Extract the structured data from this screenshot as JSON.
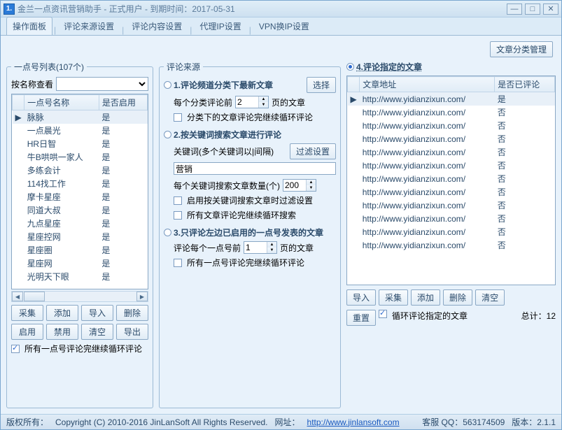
{
  "window": {
    "icon_text": "1.",
    "title": "金兰一点资讯营销助手 - 正式用户 - 到期时间：2017-05-31"
  },
  "tabs": [
    "操作面板",
    "评论来源设置",
    "评论内容设置",
    "代理IP设置",
    "VPN换IP设置"
  ],
  "btn_category_mgmt": "文章分类管理",
  "left": {
    "legend": "一点号列表(107个)",
    "filter_label": "按名称查看",
    "col1": "一点号名称",
    "col2": "是否启用",
    "rows": [
      {
        "name": "脉脉",
        "enabled": "是",
        "sel": true
      },
      {
        "name": "一点晨光",
        "enabled": "是"
      },
      {
        "name": "HR日智",
        "enabled": "是"
      },
      {
        "name": "牛B哄哄一家人",
        "enabled": "是"
      },
      {
        "name": "多练会计",
        "enabled": "是"
      },
      {
        "name": "114找工作",
        "enabled": "是"
      },
      {
        "name": "摩卡星座",
        "enabled": "是"
      },
      {
        "name": "同道大叔",
        "enabled": "是"
      },
      {
        "name": "九点星座",
        "enabled": "是"
      },
      {
        "name": "星座控网",
        "enabled": "是"
      },
      {
        "name": "星座圈",
        "enabled": "是"
      },
      {
        "name": "星座网",
        "enabled": "是"
      },
      {
        "name": "光明天下眼",
        "enabled": "是"
      }
    ],
    "btns": [
      "采集",
      "添加",
      "导入",
      "删除",
      "启用",
      "禁用",
      "清空",
      "导出"
    ],
    "loop_chk": "所有一点号评论完继续循环评论"
  },
  "mid": {
    "legend": "评论来源",
    "sec1": {
      "title": "1.评论频道分类下最新文章",
      "select_btn": "选择",
      "line1a": "每个分类评论前",
      "line1_val": "2",
      "line1b": "页的文章",
      "chk1": "分类下的文章评论完继续循环评论"
    },
    "sec2": {
      "title": "2.按关键词搜索文章进行评论",
      "kw_label": "关键词(多个关键词以|间隔)",
      "filter_btn": "过滤设置",
      "kw_val": "营销",
      "cnt_label": "每个关键词搜索文章数量(个)",
      "cnt_val": "200",
      "chk1": "启用按关键词搜索文章时过滤设置",
      "chk2": "所有文章评论完继续循环搜索"
    },
    "sec3": {
      "title": "3.只评论左边已启用的一点号发表的文章",
      "line1a": "评论每个一点号前",
      "line1_val": "1",
      "line1b": "页的文章",
      "chk1": "所有一点号评论完继续循环评论"
    }
  },
  "right": {
    "title": "4.评论指定的文章",
    "col1": "文章地址",
    "col2": "是否已评论",
    "rows": [
      {
        "url": "http://www.yidianzixun.com/",
        "done": "是",
        "sel": true
      },
      {
        "url": "http://www.yidianzixun.com/",
        "done": "否"
      },
      {
        "url": "http://www.yidianzixun.com/",
        "done": "否"
      },
      {
        "url": "http://www.yidianzixun.com/",
        "done": "否"
      },
      {
        "url": "http://www.yidianzixun.com/",
        "done": "否"
      },
      {
        "url": "http://www.yidianzixun.com/",
        "done": "否"
      },
      {
        "url": "http://www.yidianzixun.com/",
        "done": "否"
      },
      {
        "url": "http://www.yidianzixun.com/",
        "done": "否"
      },
      {
        "url": "http://www.yidianzixun.com/",
        "done": "否"
      },
      {
        "url": "http://www.yidianzixun.com/",
        "done": "否"
      },
      {
        "url": "http://www.yidianzixun.com/",
        "done": "否"
      },
      {
        "url": "http://www.yidianzixun.com/",
        "done": "否"
      }
    ],
    "btns1": [
      "导入",
      "采集",
      "添加",
      "删除",
      "清空"
    ],
    "reset_btn": "重置",
    "loop_chk": "循环评论指定的文章",
    "total": "总计：12"
  },
  "footer": {
    "copyright_label": "版权所有：",
    "copyright": "Copyright (C) 2010-2016 JinLanSoft All Rights Reserved.",
    "site_label": "网址：",
    "site": "http://www.jinlansoft.com",
    "qq": "客服 QQ：563174509",
    "ver": "版本：2.1.1"
  }
}
